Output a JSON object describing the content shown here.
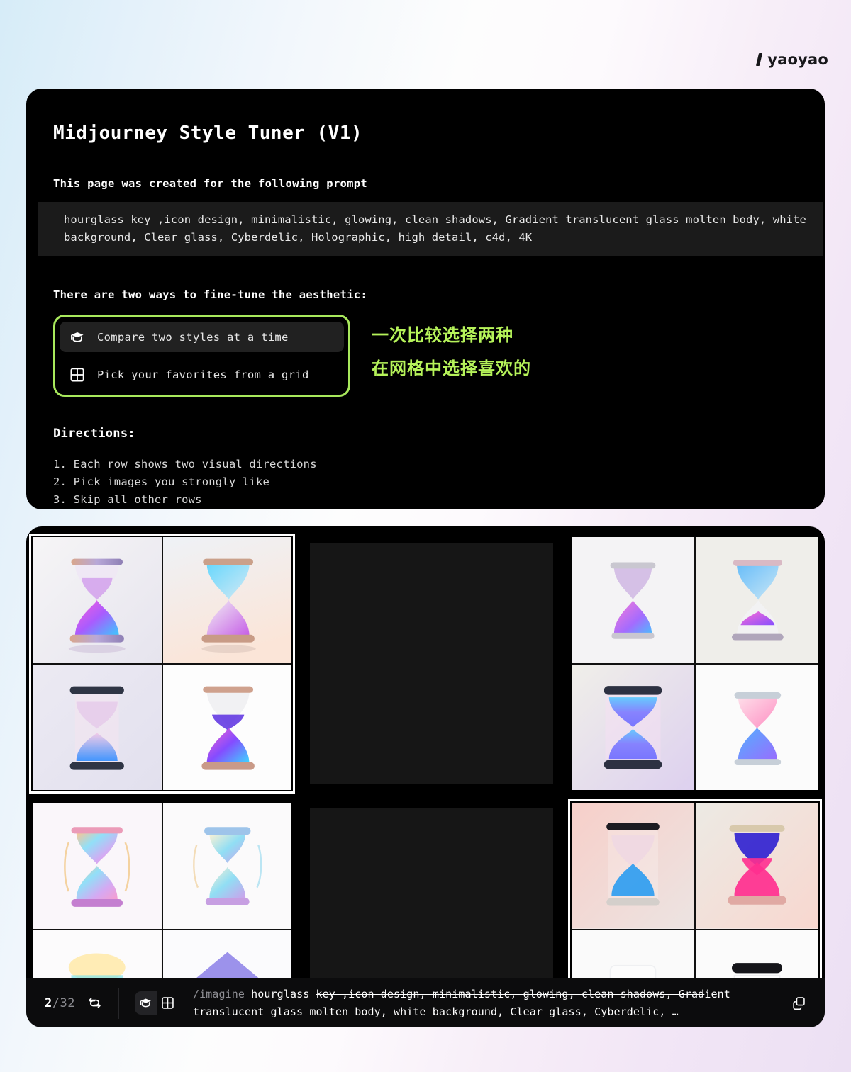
{
  "brand": {
    "name": "yaoyao",
    "mark": "slanted-bar-logo"
  },
  "info_panel": {
    "title": "Midjourney Style Tuner (V1)",
    "prompt_heading": "This page was created for the following prompt",
    "prompt_text": "hourglass key ,icon design, minimalistic, glowing, clean shadows, Gradient translucent glass molten body, white background, Clear glass, Cyberdelic, Holographic, high detail, c4d, 4K",
    "ways_heading": "There are two ways to fine-tune the aesthetic:",
    "options": [
      {
        "label": "Compare two styles at a time",
        "icon": "graduation-cap-icon",
        "selected": true
      },
      {
        "label": "Pick your favorites from a grid",
        "icon": "grid-icon",
        "selected": false
      }
    ],
    "annotations": [
      "一次比较选择两种",
      "在网格中选择喜欢的"
    ],
    "annotation_color": "#b6f35a",
    "highlight_border_color": "#a8e85c",
    "directions_heading": "Directions:",
    "directions": [
      "1. Each row shows two visual directions",
      "2. Pick images you strongly like",
      "3. Skip all other rows"
    ]
  },
  "results": {
    "rows": [
      {
        "cells": [
          {
            "kind": "quad",
            "selected": true,
            "style": "glossy-chrome-hourglass"
          },
          {
            "kind": "placeholder",
            "selected": false,
            "style": "empty"
          },
          {
            "kind": "quad",
            "selected": false,
            "style": "soft-violet-hourglass"
          }
        ]
      },
      {
        "cells": [
          {
            "kind": "quad",
            "selected": false,
            "style": "pastel-illustrated-hourglass"
          },
          {
            "kind": "placeholder",
            "selected": false,
            "style": "empty"
          },
          {
            "kind": "quad",
            "selected": true,
            "style": "photoreal-pink-blue-hourglass"
          }
        ]
      }
    ]
  },
  "bottom_bar": {
    "current_page": "2",
    "total_pages": "/32",
    "refresh_icon": "refresh-icon",
    "mode_toggle": [
      {
        "icon": "graduation-cap-icon",
        "active": true
      },
      {
        "icon": "grid-icon",
        "active": false
      }
    ],
    "prompt_command": "/imagine ",
    "prompt_line1_plain": "hourglass ",
    "prompt_line1_struck": "key ,icon design, minimalistic, glowing, clean shadows, Grad",
    "prompt_line1_tail": "ient",
    "prompt_line2_struck": "translucent glass molten body, white background, Clear glass, Cyberd",
    "prompt_line2_tail": "elic, …",
    "copy_icon": "copy-icon"
  }
}
